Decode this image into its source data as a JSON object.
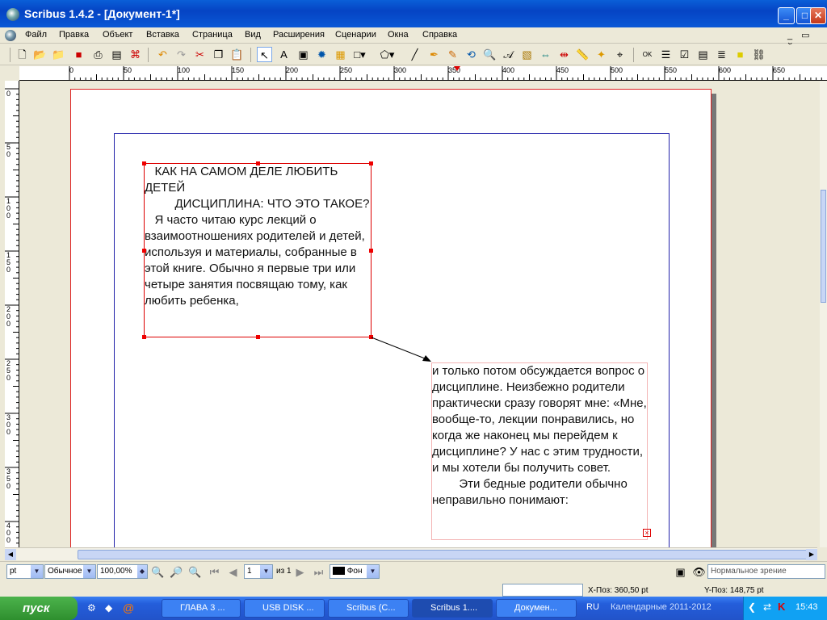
{
  "window": {
    "title": "Scribus 1.4.2 - [Документ-1*]",
    "minimize": "_",
    "maximize": "□",
    "close": "✕",
    "doc_restore": "_ ▭ ×"
  },
  "menu": {
    "file": "Файл",
    "edit": "Правка",
    "object": "Объект",
    "insert": "Вставка",
    "page": "Страница",
    "view": "Вид",
    "extensions": "Расширения",
    "scripts": "Сценарии",
    "windows": "Окна",
    "help": "Справка"
  },
  "ruler": {
    "h_labels": [
      "0",
      "50",
      "100",
      "150",
      "200",
      "250",
      "300",
      "350",
      "400",
      "450",
      "500",
      "550",
      "600",
      "650"
    ],
    "v_labels": [
      "0",
      "50",
      "100",
      "150",
      "200",
      "250",
      "300",
      "350",
      "400"
    ]
  },
  "frames": {
    "frame1_text": "   КАК НА САМОМ ДЕЛЕ ЛЮБИТЬ ДЕТЕЙ\n         ДИСЦИПЛИНА: ЧТО ЭТО ТАКОЕ?\n   Я часто читаю курс лекций о взаимоотношениях родителей и детей, используя и материалы, собранные в этой книге. Обычно я первые три или четыре занятия посвящаю тому, как любить ребенка,",
    "frame2_text": "и только потом обсуждается вопрос о дисциплине. Неизбежно родители практически сразу говорят мне: «Мне, вообще-то, лекции понравились, но когда же наконец мы перейдем к дисциплине? У нас с этим трудности, и мы хотели бы получить совет.\n        Эти бедные родители обычно неправильно понимают:"
  },
  "status": {
    "unit": "pt",
    "style": "Обычное",
    "zoom": "100,00%",
    "page_number": "1",
    "page_of": "из 1",
    "layer": "Фон",
    "view_mode": "Нормальное зрение",
    "x_pos": "X-Поз:  360,50  pt",
    "y_pos": "Y-Поз:  148,75  pt"
  },
  "taskbar": {
    "start": "пуск",
    "tasks": [
      "ГЛАВА 3 ...",
      "USB DISK ...",
      "Scribus (C...",
      "Scribus 1....",
      "Докумен..."
    ],
    "lang": "RU",
    "calendar": "Календарные 2011-2012",
    "clock": "15:43"
  },
  "colors": {
    "titlebar": "#0544c4",
    "frame_border": "#dd0000",
    "margin_border": "#2222aa",
    "taskbar": "#245edb"
  }
}
